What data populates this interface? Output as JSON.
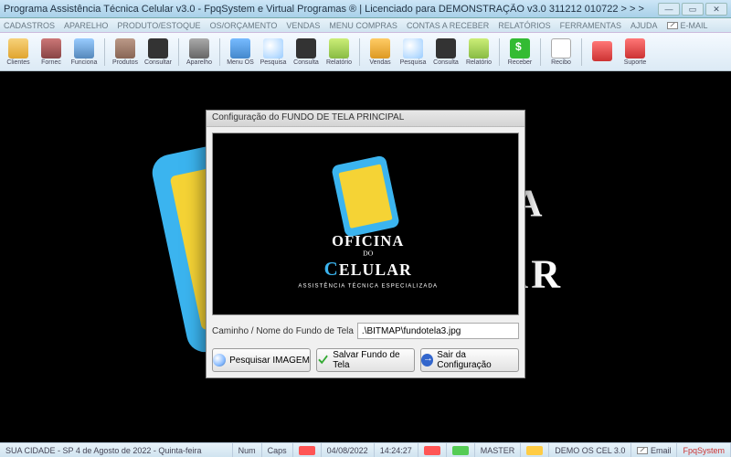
{
  "window": {
    "title": "Programa Assistência Técnica Celular v3.0 - FpqSystem e Virtual Programas ® | Licenciado para  DEMONSTRAÇÃO v3.0 311212 010722 > > >"
  },
  "menu": {
    "items": [
      "CADASTROS",
      "APARELHO",
      "PRODUTO/ESTOQUE",
      "OS/ORÇAMENTO",
      "VENDAS",
      "MENU COMPRAS",
      "CONTAS A RECEBER",
      "RELATÓRIOS",
      "FERRAMENTAS",
      "AJUDA"
    ],
    "email": "E-MAIL"
  },
  "toolbar": {
    "items": [
      {
        "label": "Clientes",
        "icon": "ic-clients",
        "name": "clientes-button"
      },
      {
        "label": "Fornec",
        "icon": "ic-fornec",
        "name": "fornec-button"
      },
      {
        "label": "Funciona",
        "icon": "ic-funcion",
        "name": "funciona-button"
      },
      {
        "sep": true
      },
      {
        "label": "Produtos",
        "icon": "ic-produt",
        "name": "produtos-button"
      },
      {
        "label": "Consultar",
        "icon": "ic-consult",
        "name": "consultar-produtos-button"
      },
      {
        "sep": true
      },
      {
        "label": "Aparelho",
        "icon": "ic-aparel",
        "name": "aparelho-button"
      },
      {
        "sep": true
      },
      {
        "label": "Menu OS",
        "icon": "ic-menu",
        "name": "menu-os-button"
      },
      {
        "label": "Pesquisa",
        "icon": "ic-pesq",
        "name": "pesquisa-os-button"
      },
      {
        "label": "Consulta",
        "icon": "ic-consult",
        "name": "consulta-os-button"
      },
      {
        "label": "Relatório",
        "icon": "ic-rel",
        "name": "relatorio-os-button"
      },
      {
        "sep": true
      },
      {
        "label": "Vendas",
        "icon": "ic-vend",
        "name": "vendas-button"
      },
      {
        "label": "Pesquisa",
        "icon": "ic-pesq",
        "name": "pesquisa-vendas-button"
      },
      {
        "label": "Consulta",
        "icon": "ic-consult",
        "name": "consulta-vendas-button"
      },
      {
        "label": "Relatório",
        "icon": "ic-rel",
        "name": "relatorio-vendas-button"
      },
      {
        "sep": true
      },
      {
        "label": "Receber",
        "icon": "ic-receb",
        "name": "receber-button"
      },
      {
        "sep": true
      },
      {
        "label": "Recibo",
        "icon": "ic-recibo",
        "name": "recibo-button"
      },
      {
        "sep": true
      },
      {
        "label": "",
        "icon": "ic-supp",
        "name": "extra1-button"
      },
      {
        "label": "Suporte",
        "icon": "ic-supp",
        "name": "suporte-button"
      }
    ]
  },
  "logo": {
    "line1": "OFICINA",
    "line2": "DO",
    "line3_cap": "C",
    "line3_rest": "ELULAR",
    "sub": "ASSISTÊNCIA TÉCNICA ESPECIALIZADA"
  },
  "dialog": {
    "title": "Configuração do FUNDO DE TELA PRINCIPAL",
    "path_label": "Caminho / Nome do Fundo de Tela",
    "path_value": ".\\BITMAP\\fundotela3.jpg",
    "btn_search": "Pesquisar IMAGEM",
    "btn_save": "Salvar Fundo de Tela",
    "btn_exit": "Sair da Configuração"
  },
  "status": {
    "left": "SUA CIDADE - SP  4 de Agosto de 2022 - Quinta-feira",
    "num": "Num",
    "caps": "Caps",
    "date": "04/08/2022",
    "time": "14:24:27",
    "master": "MASTER",
    "demo": "DEMO OS CEL 3.0",
    "email": "Email",
    "brand": "FpqSystem"
  }
}
